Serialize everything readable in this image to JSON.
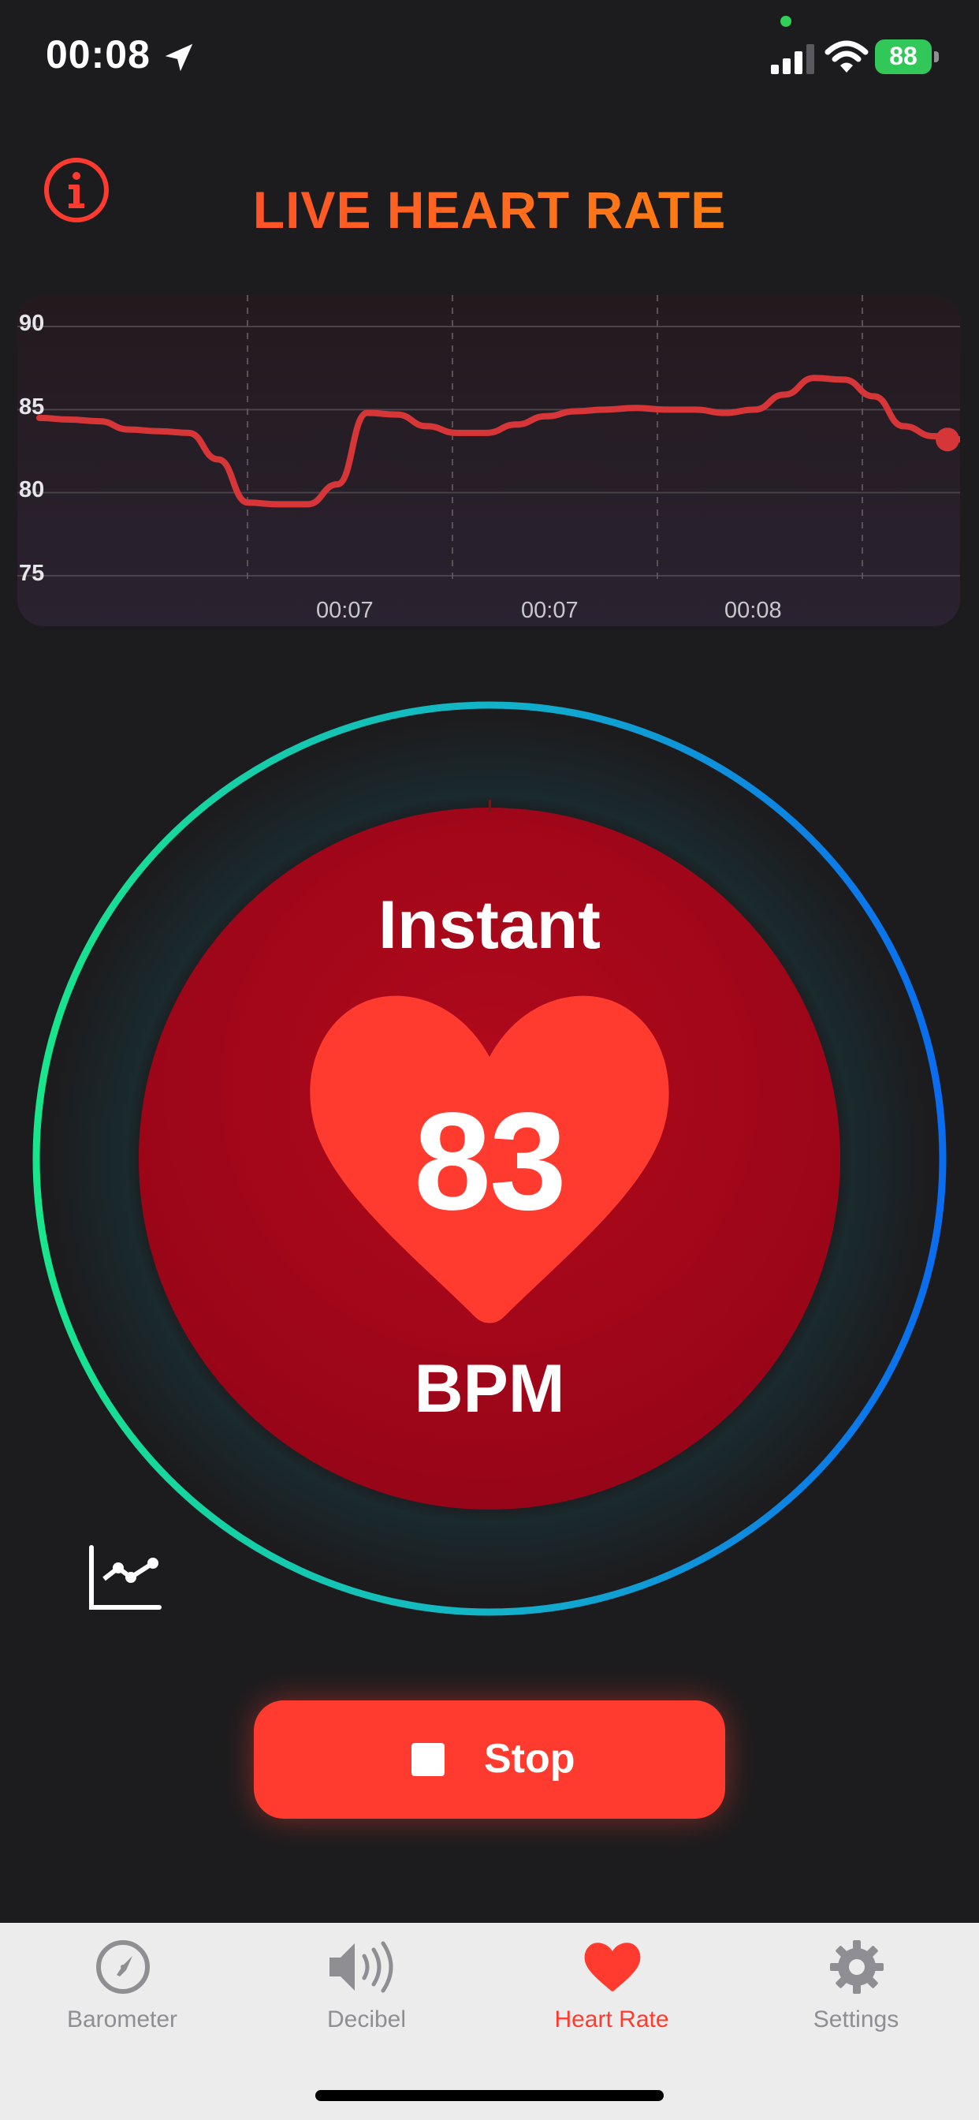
{
  "status_bar": {
    "time": "00:08",
    "battery": "88"
  },
  "header": {
    "title": "LIVE HEART RATE"
  },
  "chart_data": {
    "type": "line",
    "y_ticks": [
      "90",
      "85",
      "80",
      "75"
    ],
    "x_ticks": [
      "00:07",
      "00:07",
      "00:08"
    ],
    "ylim": [
      75,
      90
    ],
    "grid": true,
    "series": [
      {
        "values": [
          84.5,
          84.4,
          84.3,
          83.8,
          83.7,
          83.6,
          82.0,
          79.4,
          79.3,
          79.3,
          80.5,
          84.8,
          84.7,
          84.0,
          83.6,
          83.6,
          84.1,
          84.6,
          84.9,
          85.0,
          85.1,
          85.0,
          85.0,
          84.8,
          85.0,
          85.9,
          86.9,
          86.8,
          85.8,
          84.0,
          83.4,
          83.2
        ]
      }
    ],
    "color": "#d63637"
  },
  "gauge": {
    "label": "Instant",
    "value": "83",
    "unit": "BPM"
  },
  "actions": {
    "stop_label": "Stop"
  },
  "tabs": [
    {
      "label": "Barometer",
      "icon": "compass-icon",
      "active": false
    },
    {
      "label": "Decibel",
      "icon": "speaker-icon",
      "active": false
    },
    {
      "label": "Heart Rate",
      "icon": "heart-icon",
      "active": true
    },
    {
      "label": "Settings",
      "icon": "gear-icon",
      "active": false
    }
  ],
  "colors": {
    "accent": "#ff3b30",
    "ring_start": "#19e68c",
    "ring_end": "#0a6cf0",
    "background": "#1c1c1e"
  }
}
